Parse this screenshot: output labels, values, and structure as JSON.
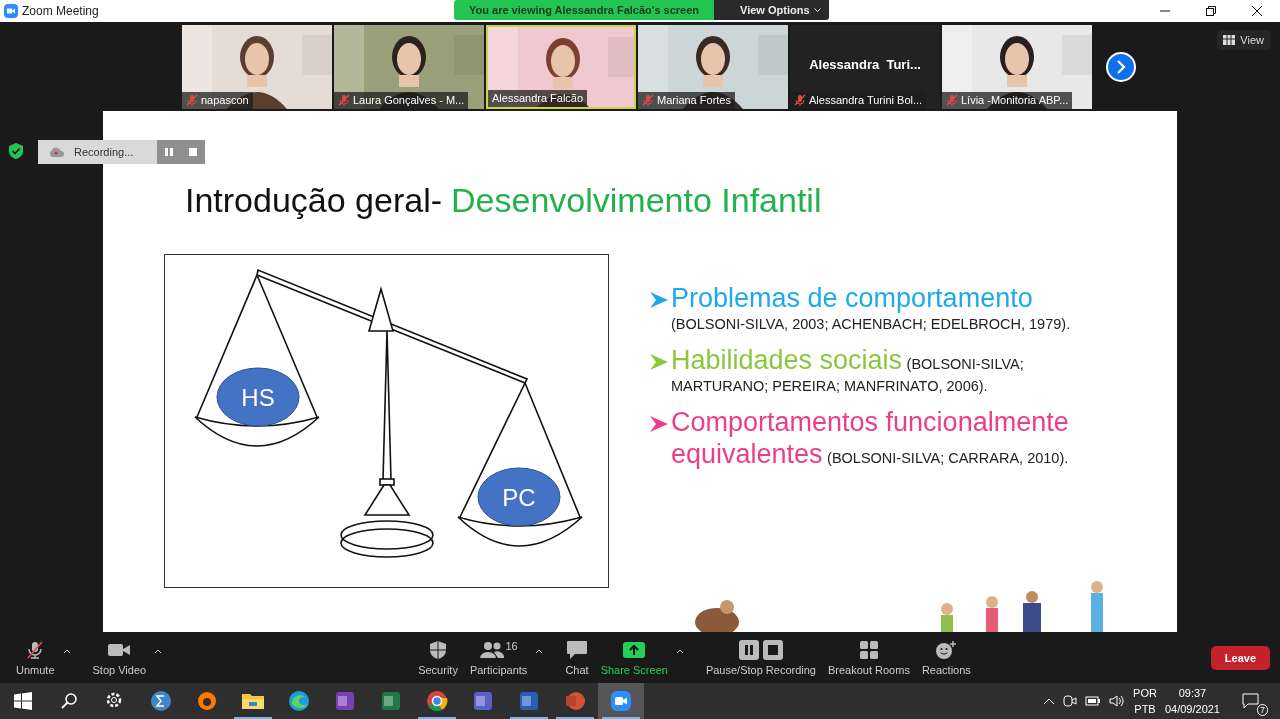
{
  "window": {
    "title": "Zoom Meeting"
  },
  "banner": {
    "text": "You are viewing Alessandra Falcão's screen",
    "options": "View Options"
  },
  "view_button": "View",
  "videos": [
    {
      "name": "napascon",
      "muted": true,
      "kind": "camera",
      "selected": false
    },
    {
      "name": "Laura Gonçalves - M...",
      "muted": true,
      "kind": "camera",
      "selected": false
    },
    {
      "name": "Alessandra Falcão",
      "muted": false,
      "kind": "camera",
      "selected": true
    },
    {
      "name": "Mariana Fortes",
      "muted": true,
      "kind": "camera",
      "selected": false
    },
    {
      "name": "Alessandra Turini Bol...",
      "muted": true,
      "kind": "name",
      "display": "Alessandra  Turi...",
      "selected": false
    },
    {
      "name": "Lívia -Monitoria ABP...",
      "muted": true,
      "kind": "camera",
      "selected": false
    }
  ],
  "recording": {
    "text": "Recording..."
  },
  "slide": {
    "title": "Introdução geral-",
    "subtitle": "Desenvolvimento Infantil",
    "scale_labels": [
      "HS",
      "PC"
    ],
    "bullets": [
      {
        "heading": "Problemas de comportamento",
        "citation": "(BOLSONI-SILVA, 2003; ACHENBACH; EDELBROCH, 1979).",
        "color": "#1eaae8"
      },
      {
        "heading": "Habilidades sociais",
        "citation": "(BOLSONI-SILVA; MARTURANO; PEREIRA; MANFRINATO, 2006).",
        "color": "#8cc63f"
      },
      {
        "heading": "Comportamentos funcionalmente equivalentes",
        "citation": "(BOLSONI-SILVA; CARRARA, 2010).",
        "color": "#ec3d8c"
      }
    ]
  },
  "toolbar": [
    {
      "kind": "mic",
      "label": "Unmute",
      "caret": true,
      "muted": true
    },
    {
      "kind": "video",
      "label": "Stop Video",
      "caret": true
    },
    {
      "kind": "security",
      "label": "Security",
      "caret": false
    },
    {
      "kind": "participants",
      "label": "Participants",
      "count": "16",
      "caret": true
    },
    {
      "kind": "chat",
      "label": "Chat",
      "caret": false
    },
    {
      "kind": "share",
      "label": "Share Screen",
      "caret": true
    },
    {
      "kind": "recording",
      "label": "Pause/Stop Recording",
      "caret": false
    },
    {
      "kind": "breakout",
      "label": "Breakout Rooms",
      "caret": false
    },
    {
      "kind": "reactions",
      "label": "Reactions",
      "caret": false
    }
  ],
  "leave": "Leave",
  "taskbar": {
    "apps": [
      {
        "kind": "start",
        "running": false,
        "selected": false
      },
      {
        "kind": "search",
        "running": false,
        "selected": false
      },
      {
        "kind": "settings",
        "running": false,
        "selected": false
      },
      {
        "kind": "math",
        "running": false,
        "selected": false
      },
      {
        "kind": "antivirus",
        "running": false,
        "selected": false
      },
      {
        "kind": "folder",
        "running": true,
        "selected": false
      },
      {
        "kind": "edge",
        "running": false,
        "selected": false
      },
      {
        "kind": "onenote",
        "running": false,
        "selected": false
      },
      {
        "kind": "excel",
        "running": false,
        "selected": false
      },
      {
        "kind": "chrome",
        "running": true,
        "selected": false
      },
      {
        "kind": "teams",
        "running": false,
        "selected": false
      },
      {
        "kind": "word",
        "running": true,
        "selected": false
      },
      {
        "kind": "powerpoint",
        "running": true,
        "selected": false
      },
      {
        "kind": "zoom",
        "running": true,
        "selected": true
      }
    ],
    "lang": [
      "POR",
      "PTB"
    ],
    "time": "09:37",
    "date": "04/09/2021",
    "notifications": "7"
  }
}
